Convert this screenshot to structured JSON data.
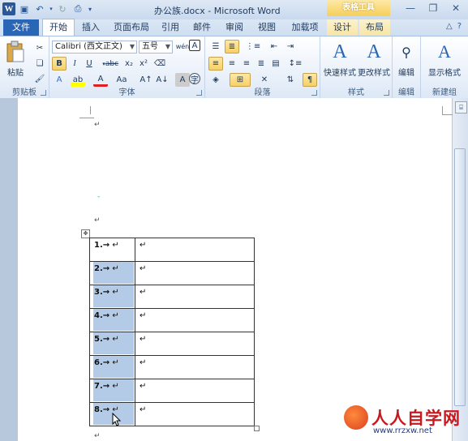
{
  "window": {
    "title": "办公族.docx - Microsoft Word",
    "context_group": "表格工具"
  },
  "tabs": [
    "开始",
    "插入",
    "页面布局",
    "引用",
    "邮件",
    "审阅",
    "视图",
    "加载项",
    "设计",
    "布局"
  ],
  "file_tab": "文件",
  "ribbon": {
    "clipboard": {
      "label": "剪贴板",
      "paste": "粘贴"
    },
    "font": {
      "label": "字体",
      "font_name": "Calibri (西文正文)",
      "font_size": "五号"
    },
    "paragraph": {
      "label": "段落"
    },
    "styles": {
      "label": "样式",
      "quick_styles": "快速样式",
      "change_styles": "更改样式"
    },
    "editing": {
      "label": "编辑",
      "edit": "编辑"
    },
    "new_group": {
      "label": "新建组",
      "show_format": "显示格式"
    }
  },
  "table": {
    "rows": [
      {
        "num": "1.→",
        "mark": "↵"
      },
      {
        "num": "2.→",
        "mark": "↵"
      },
      {
        "num": "3.→",
        "mark": "↵"
      },
      {
        "num": "4.→",
        "mark": "↵"
      },
      {
        "num": "5.→",
        "mark": "↵"
      },
      {
        "num": "6.→",
        "mark": "↵"
      },
      {
        "num": "7.→",
        "mark": "↵"
      },
      {
        "num": "8.→",
        "mark": "↵"
      }
    ],
    "selected_rows": [
      2,
      3,
      4,
      5,
      6,
      7,
      8
    ]
  },
  "watermark": {
    "name": "人人自学网",
    "url": "www.rrzxw.net"
  },
  "colors": {
    "accent": "#2a66b6",
    "selection": "#b4cbe8",
    "context": "#f6cf58"
  }
}
